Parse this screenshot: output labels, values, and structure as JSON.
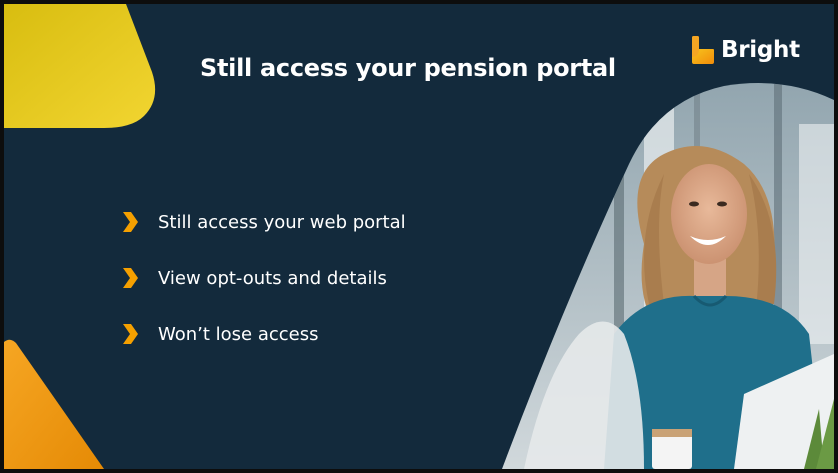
{
  "slide": {
    "title": "Still access your pension portal",
    "bullets": [
      {
        "text": "Still access your web portal"
      },
      {
        "text": "View opt-outs and details"
      },
      {
        "text": "Won’t lose access"
      }
    ]
  },
  "brand": {
    "name": "Bright"
  },
  "colors": {
    "background": "#132a3c",
    "accent_yellow": "#e2c41a",
    "accent_orange": "#f39c12",
    "text": "#ffffff"
  },
  "icons": {
    "bullet": "chevron-right-icon",
    "logo": "bright-logo-mark"
  }
}
